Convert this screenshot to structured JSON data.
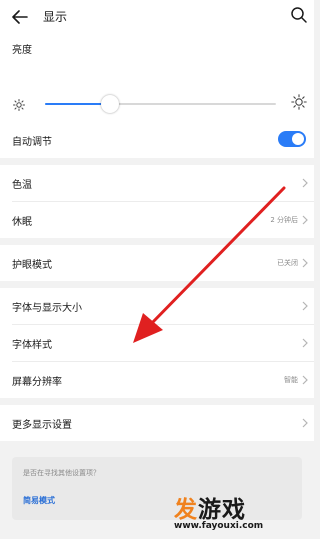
{
  "header": {
    "title": "显示"
  },
  "brightness": {
    "label": "亮度",
    "level_percent": 28
  },
  "auto_adjust": {
    "label": "自动调节",
    "enabled": true
  },
  "rows": {
    "color_temp": {
      "label": "色温"
    },
    "sleep": {
      "label": "休眠",
      "value": "2 分钟后"
    },
    "eye_care": {
      "label": "护眼模式",
      "value": "已关闭"
    },
    "font_size": {
      "label": "字体与显示大小"
    },
    "font_style": {
      "label": "字体样式"
    },
    "resolution": {
      "label": "屏幕分辨率",
      "value": "智能"
    },
    "more": {
      "label": "更多显示设置"
    }
  },
  "suggest": {
    "question": "是否在寻找其他设置项？",
    "link": "简易模式"
  },
  "watermark": {
    "name": "发游戏",
    "url": "www.fayouxi.com"
  },
  "colors": {
    "accent": "#2a7cf7",
    "annotation_arrow": "#e02020",
    "watermark_orange": "#f0821e"
  },
  "icons": [
    "back-arrow-icon",
    "search-icon",
    "sun-icon",
    "chevron-right-icon"
  ]
}
